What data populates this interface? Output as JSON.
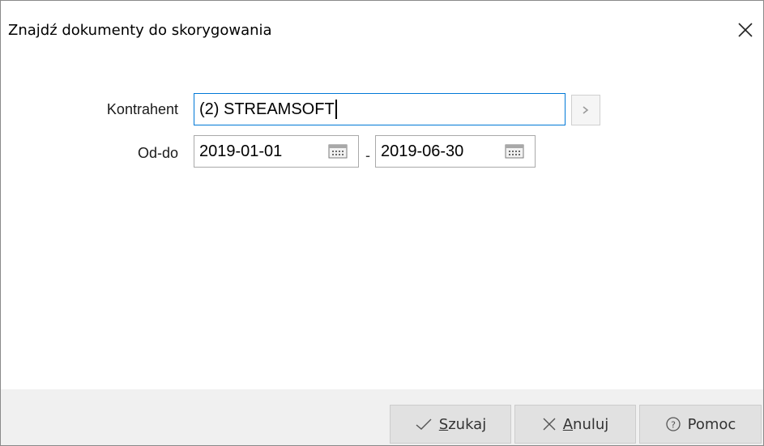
{
  "dialog": {
    "title": "Znajdź dokumenty do skorygowania"
  },
  "form": {
    "kontrahent_label": "Kontrahent",
    "kontrahent_value": "(2) STREAMSOFT",
    "oddo_label": "Od-do",
    "date_from": "2019-01-01",
    "date_separator": "-",
    "date_to": "2019-06-30"
  },
  "buttons": {
    "search_underlined": "S",
    "search_rest": "zukaj",
    "cancel_underlined": "A",
    "cancel_rest": "nuluj",
    "help_label": "Pomoc"
  },
  "icons": {
    "close": "close-icon",
    "select_arrow": "chevron-right-icon",
    "calendar": "calendar-icon",
    "check": "check-icon",
    "cancel": "x-icon",
    "help": "question-circle-icon"
  }
}
